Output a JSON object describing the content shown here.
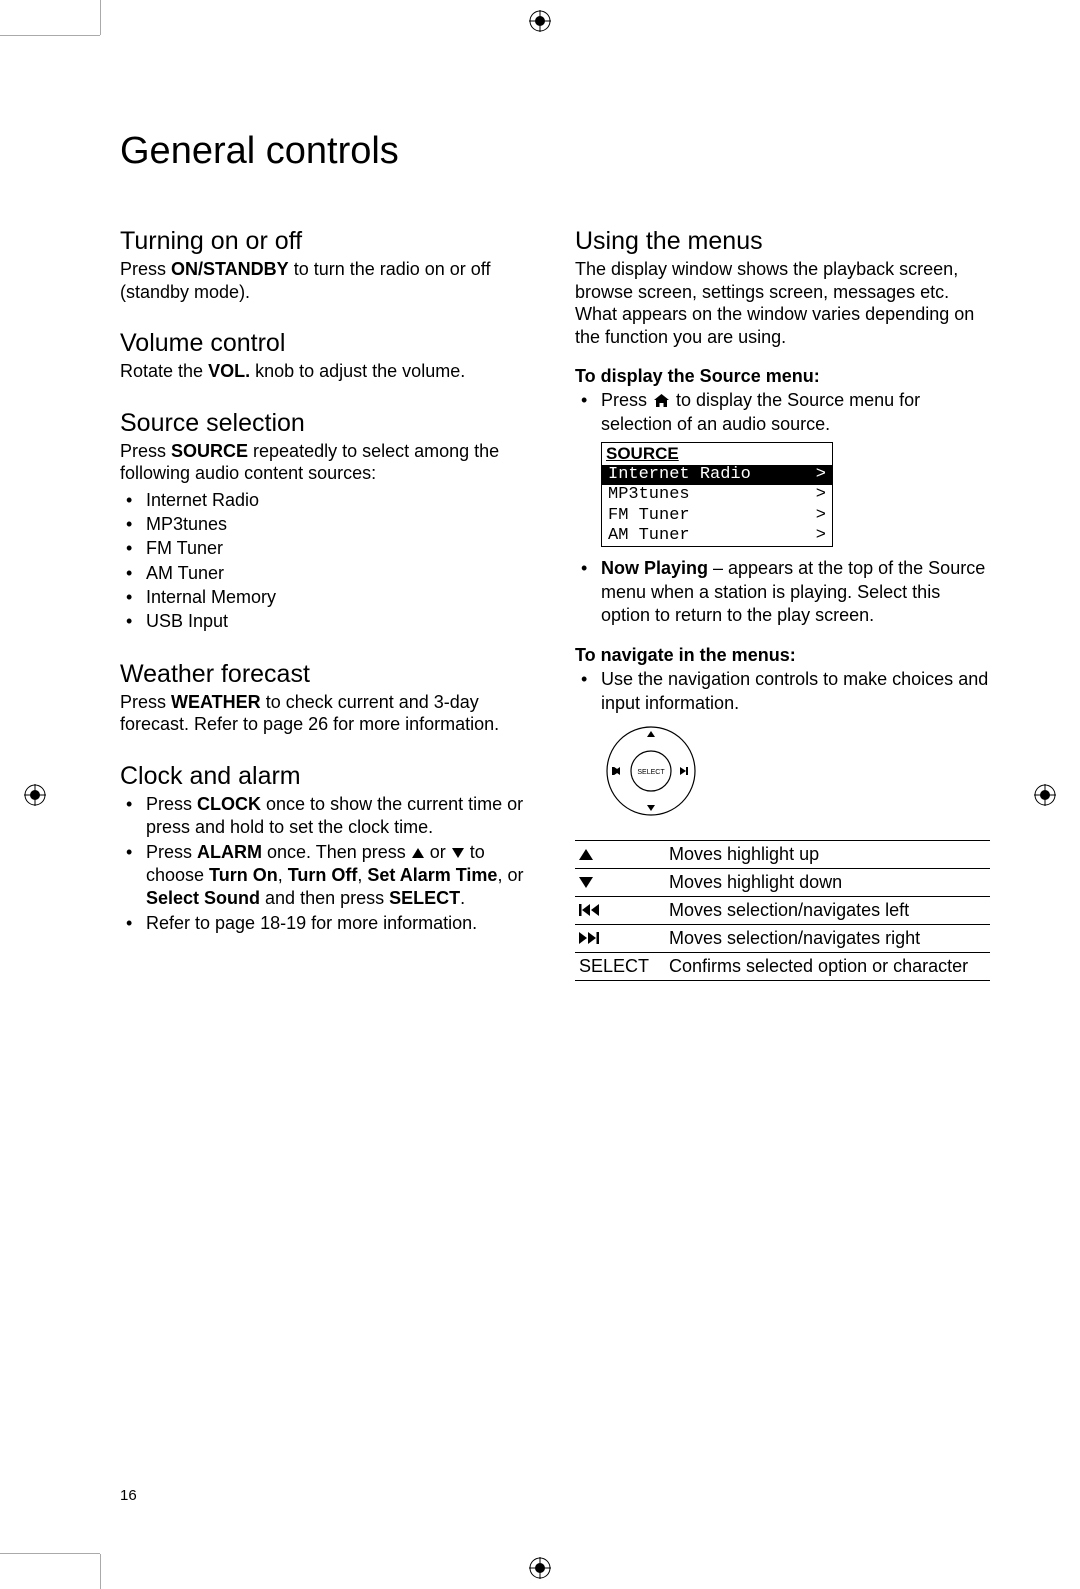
{
  "page_number": "16",
  "title": "General controls",
  "left": {
    "turning": {
      "heading": "Turning on or off",
      "text_pre": "Press ",
      "text_bold": "ON/STANDBY",
      "text_post": " to turn the radio on or off (standby mode)."
    },
    "volume": {
      "heading": "Volume control",
      "text_pre": "Rotate the ",
      "text_bold": "VOL.",
      "text_post": " knob to adjust the volume."
    },
    "source": {
      "heading": "Source selection",
      "text_pre": "Press ",
      "text_bold": "SOURCE",
      "text_post": " repeatedly to select among the following audio content sources:",
      "items": [
        "Internet Radio",
        "MP3tunes",
        "FM Tuner",
        "AM Tuner",
        "Internal Memory",
        "USB Input"
      ]
    },
    "weather": {
      "heading": "Weather forecast",
      "text_pre": "Press ",
      "text_bold": "WEATHER",
      "text_post": " to check current and 3-day forecast. Refer to page 26 for more information."
    },
    "clock": {
      "heading": "Clock and alarm",
      "b1_pre": "Press ",
      "b1_bold": "CLOCK",
      "b1_post": " once to show the current time or press and hold to set the clock time.",
      "b2_pre": "Press ",
      "b2_bold1": "ALARM",
      "b2_mid1": " once. Then press ",
      "b2_mid2": " or ",
      "b2_mid3": " to choose ",
      "b2_bold2": "Turn On",
      "b2_sep1": ", ",
      "b2_bold3": "Turn Off",
      "b2_sep2": ", ",
      "b2_bold4": "Set Alarm Time",
      "b2_sep3": ", or ",
      "b2_bold5": "Select Sound",
      "b2_mid4": " and then press ",
      "b2_bold6": "SELECT",
      "b2_end": ".",
      "b3": "Refer to page 18-19 for more information."
    }
  },
  "right": {
    "menus": {
      "heading": "Using the menus",
      "intro": "The display window shows the playback screen, browse screen, settings screen, messages etc. What appears on the window varies depending on the function you are using.",
      "source_sub": "To display the Source menu:",
      "source_b1_pre": "Press ",
      "source_b1_post": " to display the Source menu for selection of an audio source.",
      "box_head": "SOURCE",
      "box_rows": [
        {
          "label": "Internet Radio",
          "arrow": ">",
          "selected": true
        },
        {
          "label": "MP3tunes",
          "arrow": ">",
          "selected": false
        },
        {
          "label": "FM Tuner",
          "arrow": ">",
          "selected": false
        },
        {
          "label": "AM Tuner",
          "arrow": ">",
          "selected": false
        }
      ],
      "np_bold": "Now Playing",
      "np_post": " – appears at the top of the Source menu when a station is playing. Select this option to return to the play screen.",
      "nav_sub": "To navigate in the menus:",
      "nav_b1": "Use the navigation controls to make choices and input information.",
      "nav_table": [
        {
          "key": "up",
          "desc": "Moves highlight up"
        },
        {
          "key": "down",
          "desc": "Moves highlight down"
        },
        {
          "key": "prev",
          "desc": "Moves selection/navigates left"
        },
        {
          "key": "next",
          "desc": "Moves selection/navigates right"
        },
        {
          "key": "SELECT",
          "desc": "Confirms selected option or character"
        }
      ]
    }
  }
}
